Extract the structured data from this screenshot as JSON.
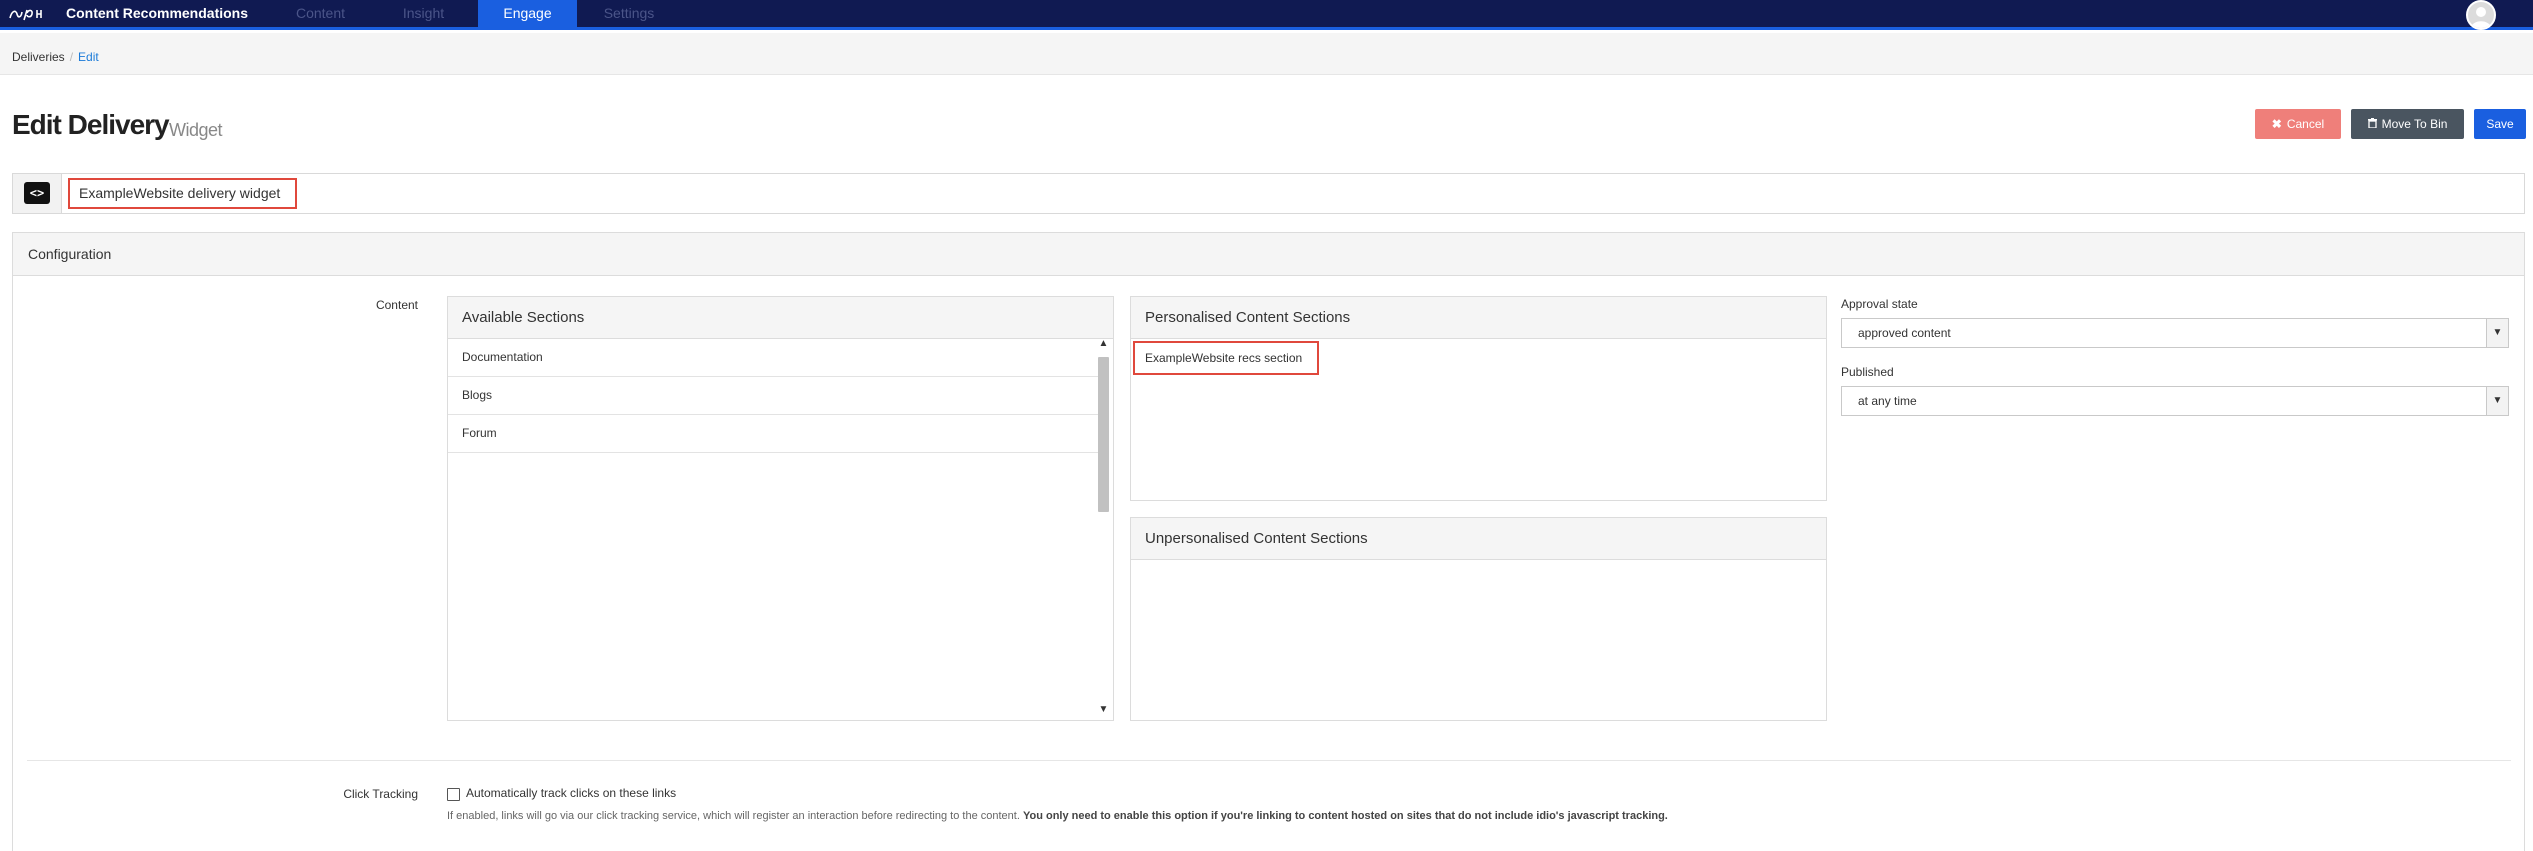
{
  "app": {
    "title": "Content Recommendations"
  },
  "nav": {
    "tabs": [
      {
        "label": "Content",
        "active": false
      },
      {
        "label": "Insight",
        "active": false
      },
      {
        "label": "Engage",
        "active": true
      },
      {
        "label": "Settings",
        "active": false
      }
    ]
  },
  "breadcrumb": {
    "items": [
      "Deliveries",
      "Edit"
    ],
    "separator": "/"
  },
  "page": {
    "title": "Edit Delivery",
    "subtitle": "Widget"
  },
  "actions": {
    "cancel_label": "Cancel",
    "cancel_glyph": "✖",
    "bin_label": "Move To Bin",
    "bin_glyph": "🗑",
    "save_label": "Save"
  },
  "delivery": {
    "name": "ExampleWebsite delivery widget",
    "icon": "<>"
  },
  "config": {
    "title": "Configuration",
    "content_label": "Content",
    "available": {
      "title": "Available Sections",
      "items": [
        "Documentation",
        "Blogs",
        "Forum"
      ]
    },
    "personalised": {
      "title": "Personalised Content Sections",
      "items": [
        "ExampleWebsite recs section"
      ]
    },
    "unpersonalised": {
      "title": "Unpersonalised Content Sections",
      "items": []
    },
    "approval": {
      "label": "Approval state",
      "value": "approved content"
    },
    "published": {
      "label": "Published",
      "value": "at any time"
    },
    "click_tracking": {
      "label": "Click Tracking",
      "checkbox_label": "Automatically track clicks on these links",
      "checked": false,
      "help": "If enabled, links will go via our click tracking service, which will register an interaction before redirecting to the content.",
      "help_bold": "You only need to enable this option if you're linking to content hosted on sites that do not include idio's javascript tracking."
    }
  },
  "colors": {
    "nav_bg": "#101a52",
    "accent": "#1a5fe0",
    "cancel": "#ef7f7a",
    "bin": "#4a5560",
    "highlight": "#e0483c"
  },
  "icons": {
    "logo": "epi-logo",
    "avatar": "user-avatar-icon",
    "code": "code-icon",
    "cancel": "close-icon",
    "bin": "trash-icon",
    "chevron": "chevron-down-icon",
    "scroll_up": "chevron-up-icon",
    "scroll_down": "chevron-down-icon"
  }
}
